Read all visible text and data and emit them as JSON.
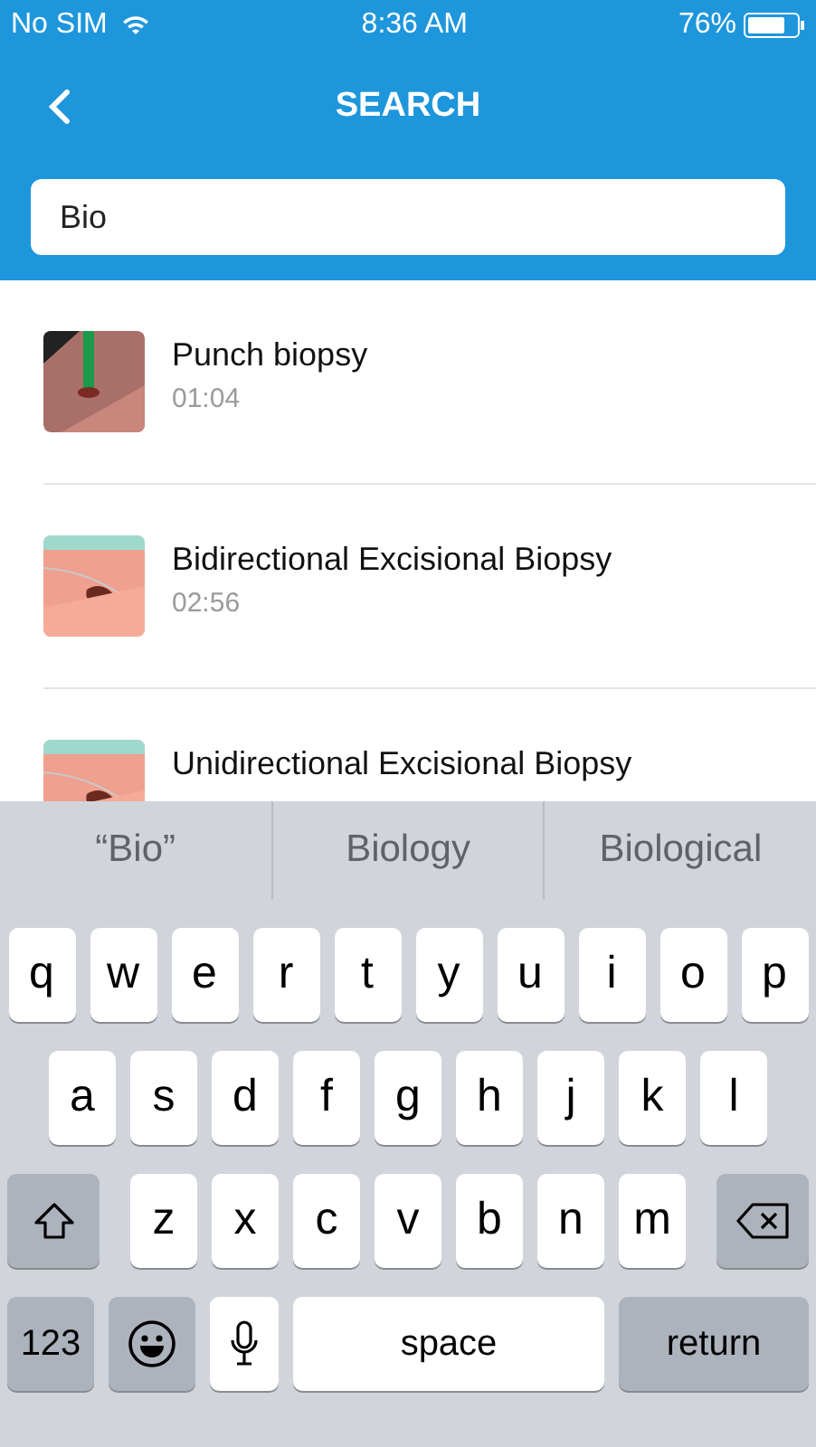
{
  "status_bar": {
    "carrier": "No SIM",
    "time": "8:36 AM",
    "battery": "76%"
  },
  "header": {
    "title": "SEARCH"
  },
  "search": {
    "value": "Bio"
  },
  "results": [
    {
      "title": "Punch biopsy",
      "duration": "01:04"
    },
    {
      "title": "Bidirectional Excisional Biopsy",
      "duration": "02:56"
    },
    {
      "title": "Unidirectional Excisional Biopsy"
    }
  ],
  "keyboard": {
    "suggestions": [
      "“Bio”",
      "Biology",
      "Biological"
    ],
    "row_1": [
      {
        "kind": "letter",
        "label": "q"
      },
      {
        "kind": "letter",
        "label": "w"
      },
      {
        "kind": "letter",
        "label": "e"
      },
      {
        "kind": "letter",
        "label": "r"
      },
      {
        "kind": "letter",
        "label": "t"
      },
      {
        "kind": "letter",
        "label": "y"
      },
      {
        "kind": "letter",
        "label": "u"
      },
      {
        "kind": "letter",
        "label": "i"
      },
      {
        "kind": "letter",
        "label": "o"
      },
      {
        "kind": "letter",
        "label": "p"
      }
    ],
    "row_2": [
      {
        "kind": "letter",
        "label": "a"
      },
      {
        "kind": "letter",
        "label": "s"
      },
      {
        "kind": "letter",
        "label": "d"
      },
      {
        "kind": "letter",
        "label": "f"
      },
      {
        "kind": "letter",
        "label": "g"
      },
      {
        "kind": "letter",
        "label": "h"
      },
      {
        "kind": "letter",
        "label": "j"
      },
      {
        "kind": "letter",
        "label": "k"
      },
      {
        "kind": "letter",
        "label": "l"
      }
    ],
    "row_3": [
      {
        "kind": "shift"
      },
      {
        "kind": "letter",
        "label": "z"
      },
      {
        "kind": "letter",
        "label": "x"
      },
      {
        "kind": "letter",
        "label": "c"
      },
      {
        "kind": "letter",
        "label": "v"
      },
      {
        "kind": "letter",
        "label": "b"
      },
      {
        "kind": "letter",
        "label": "n"
      },
      {
        "kind": "letter",
        "label": "m"
      },
      {
        "kind": "delete"
      }
    ],
    "row_4": [
      {
        "kind": "numbers",
        "label": "123"
      },
      {
        "kind": "emoji"
      },
      {
        "kind": "mic"
      },
      {
        "kind": "space",
        "label": "space"
      },
      {
        "kind": "return",
        "label": "return"
      }
    ]
  }
}
